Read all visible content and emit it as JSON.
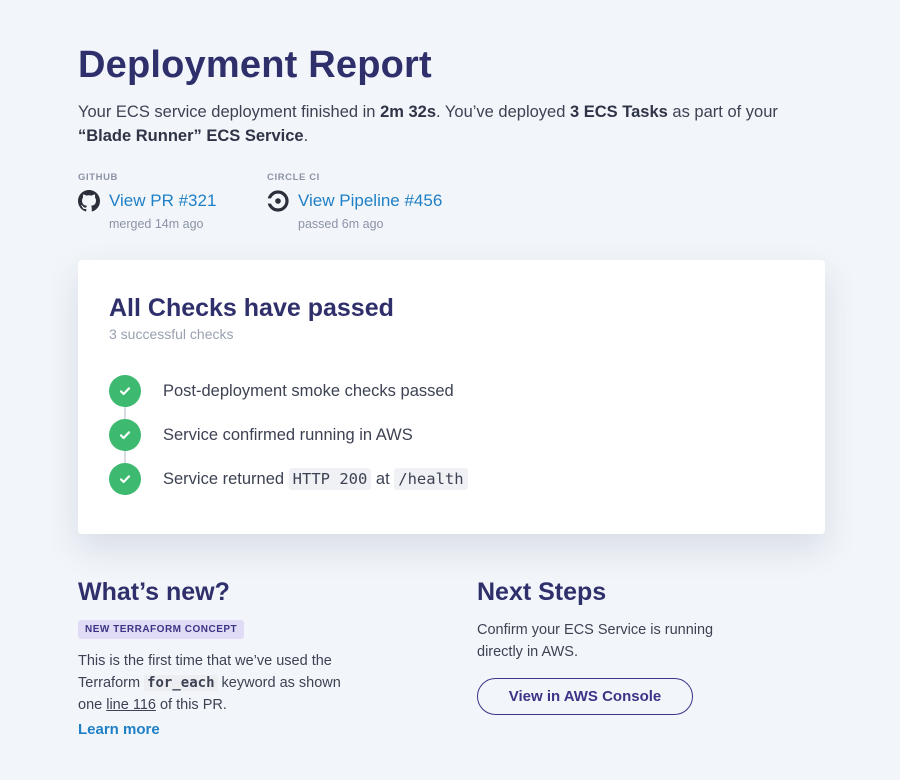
{
  "header": {
    "title": "Deployment Report",
    "summary_pre": "Your ECS service deployment finished in ",
    "duration": "2m 32s",
    "summary_mid": ". You’ve deployed ",
    "tasks": "3 ECS Tasks",
    "summary_post": " as part of your ",
    "service": "“Blade Runner” ECS Service",
    "summary_end": "."
  },
  "sources": [
    {
      "label": "GITHUB",
      "icon": "github-icon",
      "link": "View PR #321",
      "sub": "merged 14m ago"
    },
    {
      "label": "CIRCLE CI",
      "icon": "circleci-icon",
      "link": "View Pipeline #456",
      "sub": "passed 6m ago"
    }
  ],
  "checks_card": {
    "title": "All Checks have passed",
    "subtitle": "3 successful checks",
    "items": [
      {
        "text": "Post-deployment smoke checks passed"
      },
      {
        "text": "Service confirmed running in AWS"
      },
      {
        "pre": "Service returned ",
        "code1": "HTTP 200",
        "mid": " at ",
        "code2": "/health"
      }
    ],
    "status_color": "#3dba6f"
  },
  "whats_new": {
    "title": "What’s new?",
    "badge": "NEW TERRAFORM CONCEPT",
    "text_pre": "This is the first time that we’ve used the Terraform ",
    "keyword": "for_each",
    "text_mid": " keyword as shown one ",
    "line_link": "line 116",
    "text_post": " of this PR.",
    "learn_more": "Learn more"
  },
  "next_steps": {
    "title": "Next Steps",
    "text": "Confirm your ECS Service is running directly in AWS.",
    "button": "View in AWS Console"
  },
  "colors": {
    "background": "#f2f6fa",
    "heading": "#2f2f6b",
    "link": "#1f7fc6",
    "success": "#3dba6f",
    "accent": "#3c3487"
  }
}
